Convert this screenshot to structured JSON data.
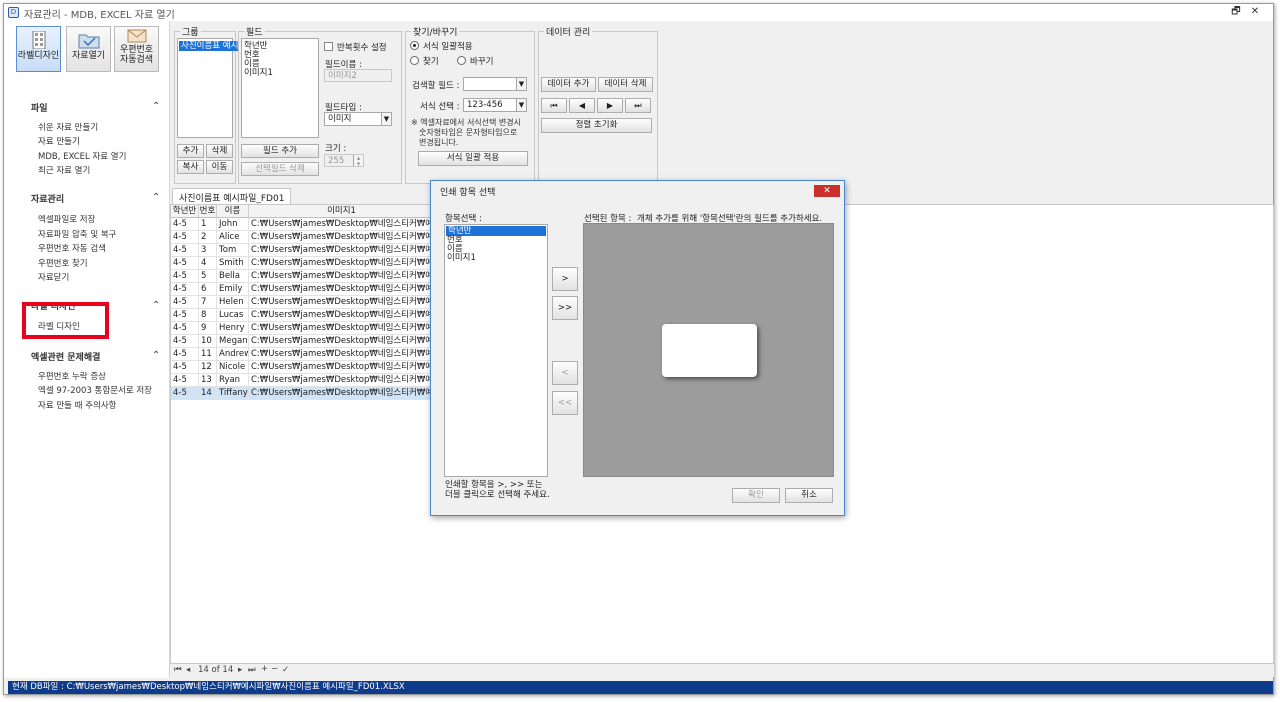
{
  "window": {
    "title": "자료관리 - MDB, EXCEL 자료 열기",
    "restore_glyph": "🗗",
    "close_glyph": "✕",
    "app_glyph": "D"
  },
  "toolbar": {
    "label_design": "라벨디자인",
    "open_data": "자료열기",
    "postal_search_1": "우편번호",
    "postal_search_2": "자동검색"
  },
  "sidebar": {
    "sections": [
      {
        "title": "파일",
        "items": [
          "쉬운 자료 만들기",
          "자료 만들기",
          "MDB, EXCEL 자료 열기",
          "최근 자료 열기"
        ]
      },
      {
        "title": "자료관리",
        "items": [
          "엑셀파일로 저장",
          "자료파일 압축 및 복구",
          "우편번호 자동 검색",
          "우편번호 찾기",
          "자료닫기"
        ]
      },
      {
        "title": "라벨 디자인",
        "items": [
          "라벨 디자인"
        ]
      },
      {
        "title": "엑셀관련 문제해결",
        "items": [
          "우편번호 누락 증상",
          "엑셀 97-2003 통합문서로 저장",
          "자료 만들 때 주의사항"
        ]
      }
    ],
    "chevron": "⌃"
  },
  "group_panel": {
    "label": "그룹",
    "items": [
      "사진이름표 예시"
    ],
    "add": "추가",
    "delete": "삭제",
    "copy": "복사",
    "move": "이동"
  },
  "field_panel": {
    "label": "필드",
    "items": [
      "학년반",
      "번호",
      "이름",
      "이미지1"
    ],
    "repeat_label": "반복횟수 설정",
    "field_name_label": "필드이름 :",
    "field_name_value": "이미지2",
    "field_type_label": "필드타입 :",
    "field_type_value": "이미지",
    "size_label": "크기 :",
    "size_value": "255",
    "add_field": "필드 추가",
    "delete_field": "선택필드 삭제"
  },
  "find_panel": {
    "label": "찾기/바꾸기",
    "opt_format": "서식 일괄적용",
    "opt_find": "찾기",
    "opt_replace": "바꾸기",
    "search_field_label": "검색할 필드 :",
    "search_field_value": "",
    "format_label": "서식 선택 :",
    "format_value": "123-456",
    "note_1": "※ 엑셀자료에서 서식선택 변경시",
    "note_2": "숫자형타입은 문자형타입으로",
    "note_3": "변경됩니다.",
    "apply": "서식 일괄 적용"
  },
  "data_panel": {
    "label": "데이터 관리",
    "add": "데이터 추가",
    "delete": "데이터 삭제",
    "reset_sort": "정렬 초기화",
    "nav_first": "⏮",
    "nav_prev": "◀",
    "nav_next": "▶",
    "nav_last": "⏭"
  },
  "tab": {
    "label": "사진이름표 예시파일_FD01"
  },
  "grid": {
    "columns": [
      "학년반",
      "번호",
      "이름",
      "이미지1"
    ],
    "rows": [
      [
        "4-5",
        "1",
        "John",
        "C:₩Users₩james₩Desktop₩네임스티커₩예시파일₩"
      ],
      [
        "4-5",
        "2",
        "Alice",
        "C:₩Users₩james₩Desktop₩네임스티커₩예시파일₩"
      ],
      [
        "4-5",
        "3",
        "Tom",
        "C:₩Users₩james₩Desktop₩네임스티커₩예시파일₩"
      ],
      [
        "4-5",
        "4",
        "Smith",
        "C:₩Users₩james₩Desktop₩네임스티커₩예시파일₩"
      ],
      [
        "4-5",
        "5",
        "Bella",
        "C:₩Users₩james₩Desktop₩네임스티커₩예시파일₩"
      ],
      [
        "4-5",
        "6",
        "Emily",
        "C:₩Users₩james₩Desktop₩네임스티커₩예시파일₩"
      ],
      [
        "4-5",
        "7",
        "Helen",
        "C:₩Users₩james₩Desktop₩네임스티커₩예시파일₩"
      ],
      [
        "4-5",
        "8",
        "Lucas",
        "C:₩Users₩james₩Desktop₩네임스티커₩예시파일₩"
      ],
      [
        "4-5",
        "9",
        "Henry",
        "C:₩Users₩james₩Desktop₩네임스티커₩예시파일₩"
      ],
      [
        "4-5",
        "10",
        "Megan",
        "C:₩Users₩james₩Desktop₩네임스티커₩예시파일₩"
      ],
      [
        "4-5",
        "11",
        "Andrew",
        "C:₩Users₩james₩Desktop₩네임스티커₩예시파일₩"
      ],
      [
        "4-5",
        "12",
        "Nicole",
        "C:₩Users₩james₩Desktop₩네임스티커₩예시파일₩"
      ],
      [
        "4-5",
        "13",
        "Ryan",
        "C:₩Users₩james₩Desktop₩네임스티커₩예시파일₩"
      ],
      [
        "4-5",
        "14",
        "Tiffany",
        "C:₩Users₩james₩Desktop₩네임스티커₩예시파일₩"
      ]
    ],
    "selected_row": 13
  },
  "navigator": {
    "page_text": "14 of 14",
    "first": "⏮",
    "prev": "◂",
    "next": "▸",
    "last": "⏭",
    "add": "+",
    "remove": "−",
    "confirm": "✓"
  },
  "status": {
    "text": "현재 DB파일 : C:₩Users₩james₩Desktop₩네임스티커₩예시파일₩사진이름표 예시파일_FD01.XLSX"
  },
  "dialog": {
    "title": "인쇄 항목 선택",
    "close_glyph": "✕",
    "items_label": "항목선택 :",
    "items": [
      "학년반",
      "번호",
      "이름",
      "이미지1"
    ],
    "selected_label": "선택된 항목 :",
    "selected_hint": "개체 추가를 위해 '항목선택'란의 필드를 추가하세요.",
    "move_right": ">",
    "move_all_right": ">>",
    "move_left": "<",
    "move_all_left": "<<",
    "help_1": "인쇄할 항목을 >, >> 또는",
    "help_2": "더블 클릭으로 선택해 주세요.",
    "ok": "확인",
    "cancel": "취소"
  }
}
